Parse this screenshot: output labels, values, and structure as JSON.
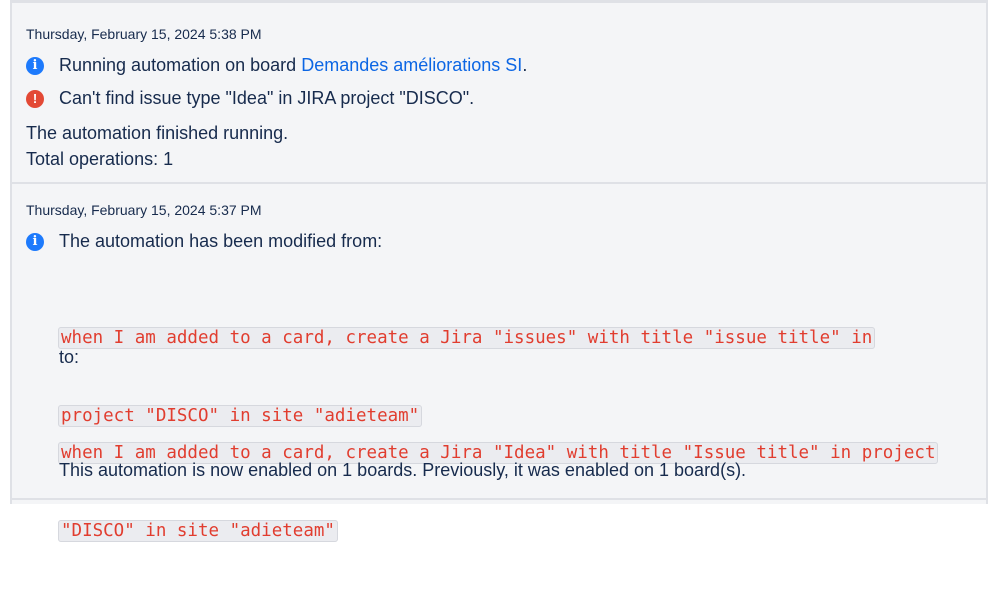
{
  "entries": [
    {
      "timestamp": "Thursday, February 15, 2024 5:38 PM",
      "lines": [
        {
          "icon": "info-icon",
          "text": "Running automation on board ",
          "link": "Demandes améliorations SI",
          "suffix": "."
        },
        {
          "icon": "error-icon",
          "text": "Can't find issue type \"Idea\" in JIRA project \"DISCO\"."
        }
      ],
      "summary": [
        "The automation finished running.",
        "Total operations: 1"
      ]
    },
    {
      "timestamp": "Thursday, February 15, 2024 5:37 PM",
      "intro": "The automation has been modified from:",
      "from_code": [
        "when I am added to a card, create a Jira \"issues\" with title \"issue title\" in",
        "project \"DISCO\" in site \"adieteam\""
      ],
      "to_label": "to:",
      "to_code": [
        "when I am added to a card, create a Jira \"Idea\" with title \"Issue title\" in project",
        "\"DISCO\" in site \"adieteam\""
      ],
      "footer": "This automation is now enabled on 1 boards. Previously, it was enabled on 1 board(s)."
    }
  ],
  "colors": {
    "info": "#1d7afc",
    "error": "#e34935",
    "link": "#0c66e4",
    "code": "#e13d2f"
  }
}
